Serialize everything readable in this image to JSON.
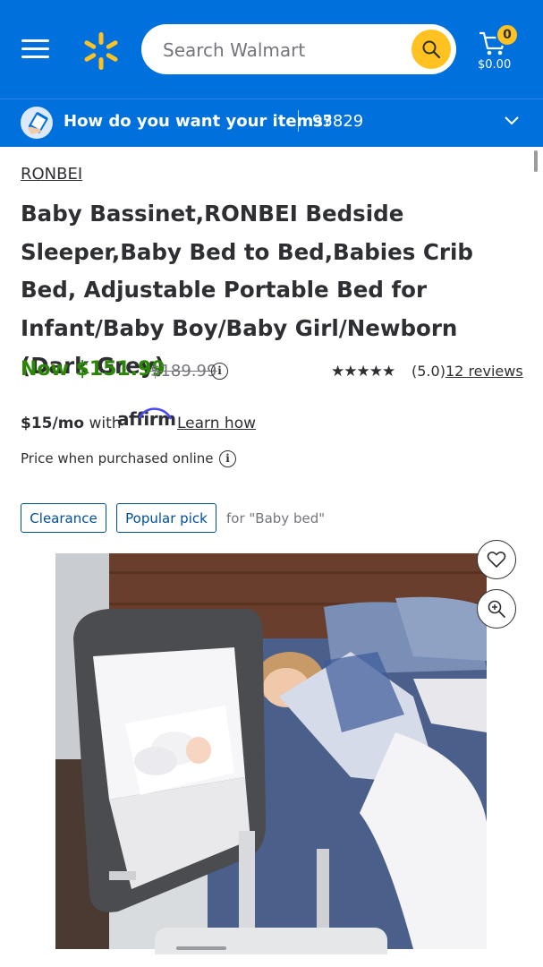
{
  "header": {
    "search_placeholder": "Search Walmart",
    "cart_count": "0",
    "cart_total": "$0.00"
  },
  "fulfillment": {
    "prompt": "How do you want your items?",
    "zip": "95829"
  },
  "product": {
    "brand": "RONBEI",
    "title": "Baby Bassinet,RONBEI Bedside Sleeper,Baby Bed to Bed,Babies Crib Bed, Adjustable Portable Bed for Infant/Baby Boy/Baby Girl/Newborn (Dark Grey)",
    "price_now": "Now $151.99",
    "price_was": "$189.99",
    "stars": "★★★★★",
    "rating": "(5.0)",
    "reviews": "12 reviews",
    "monthly_amount": "$15/mo",
    "monthly_with": "with",
    "affirm": "affirm",
    "learn_how": "Learn how",
    "price_note": "Price when purchased online",
    "tags": [
      "Clearance",
      "Popular pick"
    ],
    "tag_context": "for \"Baby bed\""
  },
  "colors": {
    "walmart_blue": "#0071dc",
    "spark_yellow": "#ffc220",
    "price_green": "#2a8703",
    "tag_blue": "#004f9a"
  },
  "icons": [
    "menu-icon",
    "walmart-spark-logo",
    "search-icon",
    "cart-icon",
    "fulfillment-icon",
    "chevron-down-icon",
    "info-icon",
    "heart-icon",
    "zoom-in-icon"
  ]
}
